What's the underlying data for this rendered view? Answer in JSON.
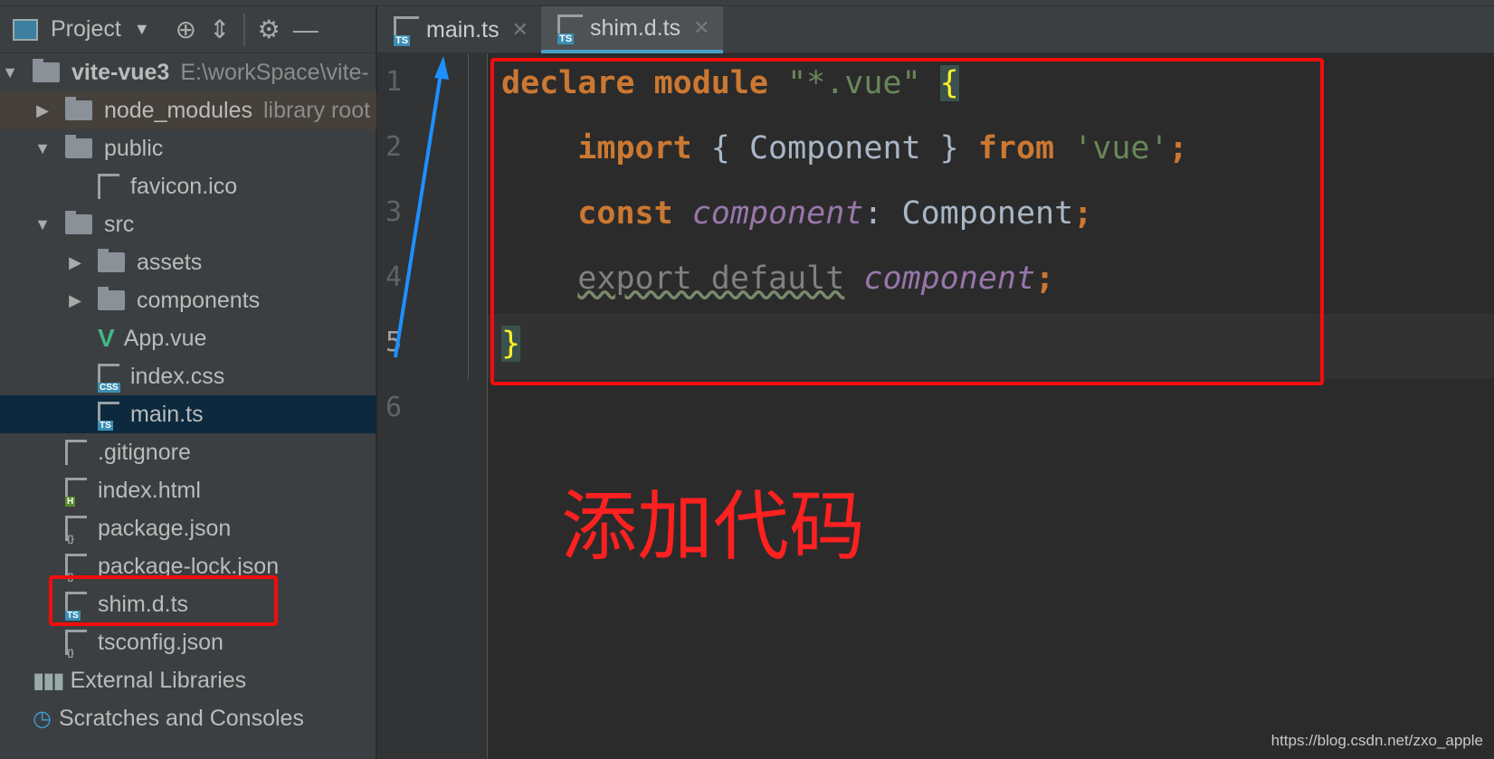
{
  "sidebar": {
    "title": "Project",
    "items": [
      {
        "label": "vite-vue3",
        "sub": "E:\\workSpace\\vite-",
        "type": "folder",
        "arrow": "▼",
        "indent": 0,
        "bold": true
      },
      {
        "label": "node_modules",
        "sub": "library root",
        "type": "folder",
        "arrow": "▶",
        "indent": 1,
        "bg": "#45403a"
      },
      {
        "label": "public",
        "type": "folder",
        "arrow": "▼",
        "indent": 1
      },
      {
        "label": "favicon.ico",
        "type": "file",
        "badge": "",
        "indent": 3
      },
      {
        "label": "src",
        "type": "folder",
        "arrow": "▼",
        "indent": 1
      },
      {
        "label": "assets",
        "type": "folder",
        "arrow": "▶",
        "indent": 2
      },
      {
        "label": "components",
        "type": "folder",
        "arrow": "▶",
        "indent": 2
      },
      {
        "label": "App.vue",
        "type": "vue",
        "indent": 3
      },
      {
        "label": "index.css",
        "type": "file",
        "badge": "CSS",
        "badgeColor": "#3b8fb3",
        "indent": 3
      },
      {
        "label": "main.ts",
        "type": "file",
        "badge": "TS",
        "badgeColor": "#3b8fb3",
        "indent": 3,
        "bg": "#0d293e"
      },
      {
        "label": ".gitignore",
        "type": "file",
        "badge": "",
        "indent": 2
      },
      {
        "label": "index.html",
        "type": "file",
        "badge": "H",
        "badgeColor": "#5a8a2e",
        "indent": 2
      },
      {
        "label": "package.json",
        "type": "file",
        "badge": "{}",
        "indent": 2
      },
      {
        "label": "package-lock.json",
        "type": "file",
        "badge": "{}",
        "indent": 2
      },
      {
        "label": "shim.d.ts",
        "type": "file",
        "badge": "TS",
        "badgeColor": "#3b8fb3",
        "indent": 2
      },
      {
        "label": "tsconfig.json",
        "type": "file",
        "badge": "{}",
        "indent": 2
      },
      {
        "label": "External Libraries",
        "type": "lib",
        "indent": 1
      },
      {
        "label": "Scratches and Consoles",
        "type": "scratch",
        "indent": 1
      }
    ]
  },
  "tabs": [
    {
      "label": "main.ts",
      "active": false
    },
    {
      "label": "shim.d.ts",
      "active": true
    }
  ],
  "editor": {
    "line_numbers": [
      "1",
      "2",
      "3",
      "4",
      "5",
      "6"
    ],
    "lines": [
      [
        {
          "t": "declare module ",
          "c": "kw"
        },
        {
          "t": "\"*.vue\"",
          "c": "str"
        },
        {
          "t": " "
        },
        {
          "t": "{",
          "c": "br"
        }
      ],
      [
        {
          "t": "    "
        },
        {
          "t": "import",
          "c": "kw"
        },
        {
          "t": " { Component } "
        },
        {
          "t": "from",
          "c": "kw"
        },
        {
          "t": " "
        },
        {
          "t": "'vue'",
          "c": "str"
        },
        {
          "t": ";",
          "c": "kw"
        }
      ],
      [
        {
          "t": "    "
        },
        {
          "t": "const",
          "c": "kw"
        },
        {
          "t": " "
        },
        {
          "t": "component",
          "c": "it"
        },
        {
          "t": ": Component"
        },
        {
          "t": ";",
          "c": "kw"
        }
      ],
      [
        {
          "t": "    "
        },
        {
          "t": "export default",
          "c": "unused"
        },
        {
          "t": " "
        },
        {
          "t": "component",
          "c": "it"
        },
        {
          "t": ";",
          "c": "kw"
        }
      ],
      [
        {
          "t": "}",
          "c": "br"
        }
      ],
      []
    ]
  },
  "annotation": {
    "text": "添加代码",
    "color": "#ff2020"
  },
  "watermark": "https://blog.csdn.net/zxo_apple"
}
